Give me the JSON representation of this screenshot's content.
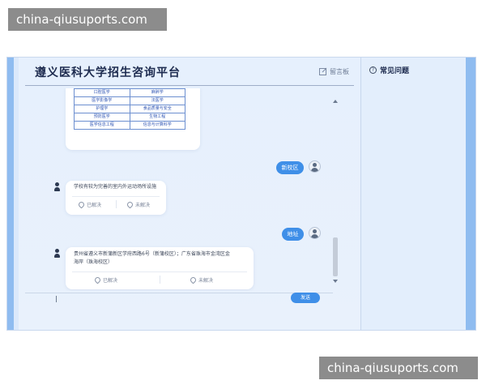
{
  "watermarks": {
    "top": "china-qiusuports.com",
    "bottom": "china-qiusuports.com"
  },
  "header": {
    "title": "遵义医科大学招生咨询平台",
    "message_board_label": "留言板",
    "message_board_icon": "edit-icon"
  },
  "faq": {
    "icon": "help-icon",
    "icon_glyph": "?",
    "title": "常见问题"
  },
  "messages": {
    "major_table": [
      [
        "口腔医学",
        "麻醉学"
      ],
      [
        "医学影像学",
        "法医学"
      ],
      [
        "护理学",
        "食品质量与安全"
      ],
      [
        "预防医学",
        "生物工程"
      ],
      [
        "医学信息工程",
        "信息与计算科学"
      ]
    ],
    "user_message_1": "新校区",
    "bot_answer_1": "学校有较为完善的室内外运动场所设施",
    "user_message_2": "地址",
    "bot_answer_2_line_1": "贵州省遵义市新蒲新区学府西路6号（新蒲校区）；广东省珠海市金湾区金",
    "bot_answer_2_line_2": "海岸（珠海校区）",
    "feedback": {
      "resolved": "已解决",
      "unresolved": "未解决"
    }
  },
  "input": {
    "send_label": "发送"
  },
  "colors": {
    "accent": "#3f8fe8",
    "panel": "#e6f0fd",
    "side_edges": "#8fbcf0",
    "table_border": "#6c8fd0"
  }
}
